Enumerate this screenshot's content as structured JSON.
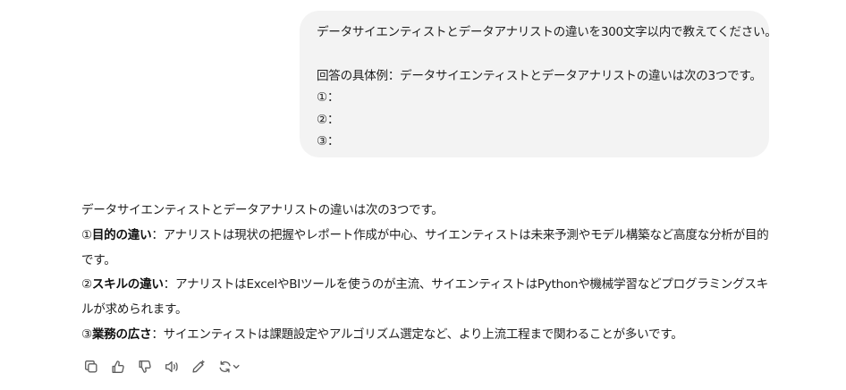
{
  "user_message": {
    "line1": "データサイエンティストとデータアナリストの違いを300文字以内で教えてください。",
    "line2": "回答の具体例：データサイエンティストとデータアナリストの違いは次の3つです。",
    "line3": "①：",
    "line4": "②：",
    "line5": "③："
  },
  "assistant_message": {
    "intro": "データサイエンティストとデータアナリストの違いは次の3つです。",
    "point1_num": "①",
    "point1_title": "目的の違い",
    "point1_body": "：アナリストは現状の把握やレポート作成が中心、サイエンティストは未来予測やモデル構築など高度な分析が目的です。",
    "point2_num": "②",
    "point2_title": "スキルの違い",
    "point2_body": "：アナリストはExcelやBIツールを使うのが主流、サイエンティストはPythonや機械学習などプログラミングスキルが求められます。",
    "point3_num": "③",
    "point3_title": "業務の広さ",
    "point3_body": "：サイエンティストは課題設定やアルゴリズム選定など、より上流工程まで関わることが多いです。"
  },
  "actions": [
    {
      "name": "copy-icon"
    },
    {
      "name": "thumbs-up-icon"
    },
    {
      "name": "thumbs-down-icon"
    },
    {
      "name": "read-aloud-icon"
    },
    {
      "name": "edit-icon"
    },
    {
      "name": "regenerate-icon"
    }
  ],
  "colors": {
    "bubble_bg": "#f3f3f3",
    "text": "#1f1f1f",
    "icon": "#5d5d5d"
  }
}
